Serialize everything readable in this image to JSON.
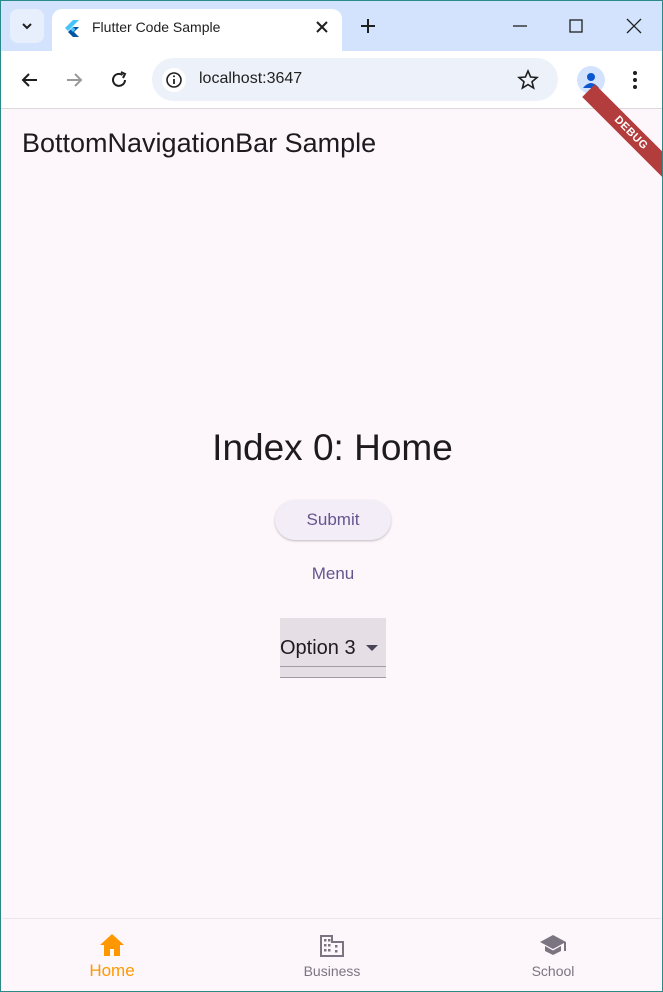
{
  "browser": {
    "tab_title": "Flutter Code Sample",
    "url": "localhost:3647",
    "icons": [
      "tab-search-icon",
      "flutter-logo-icon",
      "close-icon",
      "plus-icon",
      "minimize-icon",
      "maximize-icon",
      "window-close-icon",
      "back-icon",
      "forward-icon",
      "reload-icon",
      "site-info-icon",
      "star-icon",
      "profile-icon",
      "kebab-menu-icon"
    ]
  },
  "app": {
    "title": "BottomNavigationBar Sample",
    "debug_banner": "DEBUG",
    "index_text": "Index 0: Home",
    "submit_label": "Submit",
    "menu_label": "Menu",
    "dropdown": {
      "selected": "Option 3"
    }
  },
  "bottom_nav": {
    "items": [
      {
        "label": "Home",
        "icon": "home-icon",
        "active": true
      },
      {
        "label": "Business",
        "icon": "business-icon",
        "active": false
      },
      {
        "label": "School",
        "icon": "school-icon",
        "active": false
      }
    ],
    "active_color": "#ff9800",
    "inactive_color": "#7a7580"
  },
  "colors": {
    "accent": "#65558f",
    "background": "#fdf7fc",
    "debug_ribbon": "#b33c3c"
  }
}
